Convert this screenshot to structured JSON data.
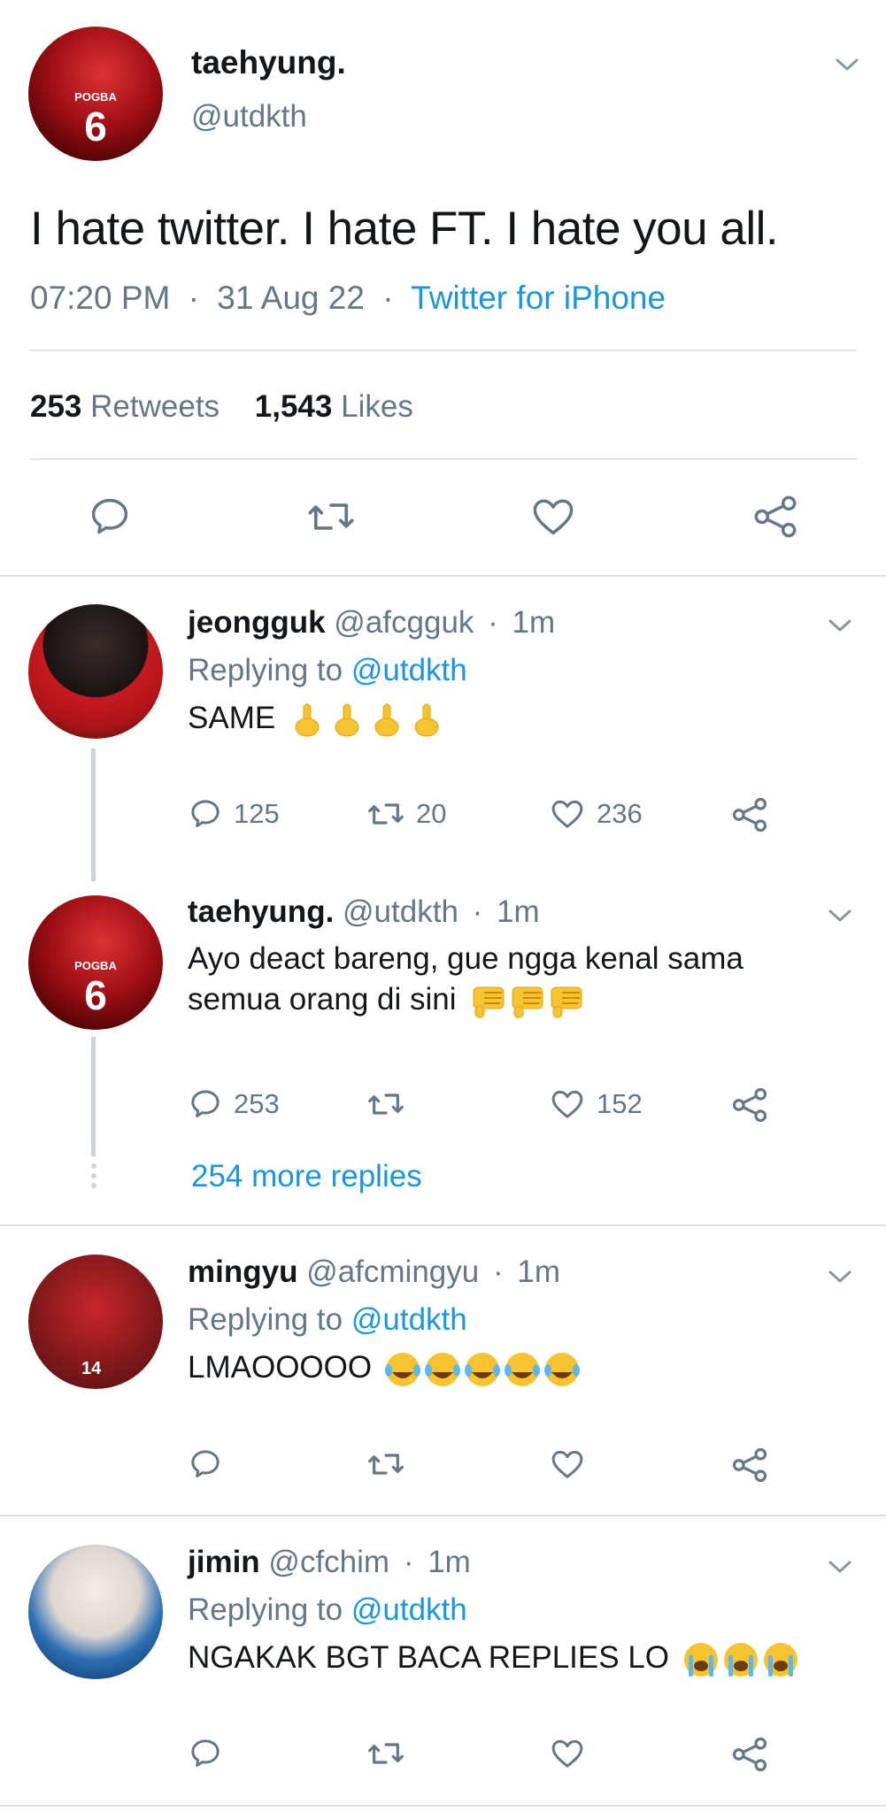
{
  "main_tweet": {
    "name": "taehyung.",
    "handle": "@utdkth",
    "avatar_text": "POGBA",
    "avatar_number": "6",
    "text": "I hate twitter. I hate FT. I hate you all.",
    "time": "07:20 PM",
    "date": "31 Aug 22",
    "source": "Twitter for iPhone",
    "retweets_count": "253",
    "retweets_label": "Retweets",
    "likes_count": "1,543",
    "likes_label": "Likes"
  },
  "replies": [
    {
      "name": "jeongguk",
      "handle": "@afcgguk",
      "time": "1m",
      "replying_label": "Replying to",
      "replying_handle": "@utdkth",
      "text": "SAME",
      "emoji": "middle-finger-emoji x4",
      "reply_count": "125",
      "retweet_count": "20",
      "like_count": "236"
    },
    {
      "name": "taehyung.",
      "handle": "@utdkth",
      "time": "1m",
      "text_line1": "Ayo deact bareng, gue ngga kenal sama",
      "text_line2": "semua orang di sini",
      "emoji": "thumbs-down-emoji x3",
      "reply_count": "253",
      "like_count": "152",
      "avatar_text": "POGBA",
      "avatar_number": "6",
      "more_replies": "254 more replies"
    },
    {
      "name": "mingyu",
      "handle": "@afcmingyu",
      "time": "1m",
      "replying_label": "Replying to",
      "replying_handle": "@utdkth",
      "text": "LMAOOOOO",
      "emoji": "loudly-crying-laughing-emoji x5",
      "avatar_number": "14"
    },
    {
      "name": "jimin",
      "handle": "@cfchim",
      "time": "1m",
      "replying_label": "Replying to",
      "replying_handle": "@utdkth",
      "text": "NGAKAK BGT BACA REPLIES LO",
      "emoji": "loudly-crying-emoji x3"
    }
  ],
  "separator": "·",
  "colors": {
    "accent": "#1b95e0",
    "secondary_text": "#657786",
    "divider": "#d9dee2"
  }
}
